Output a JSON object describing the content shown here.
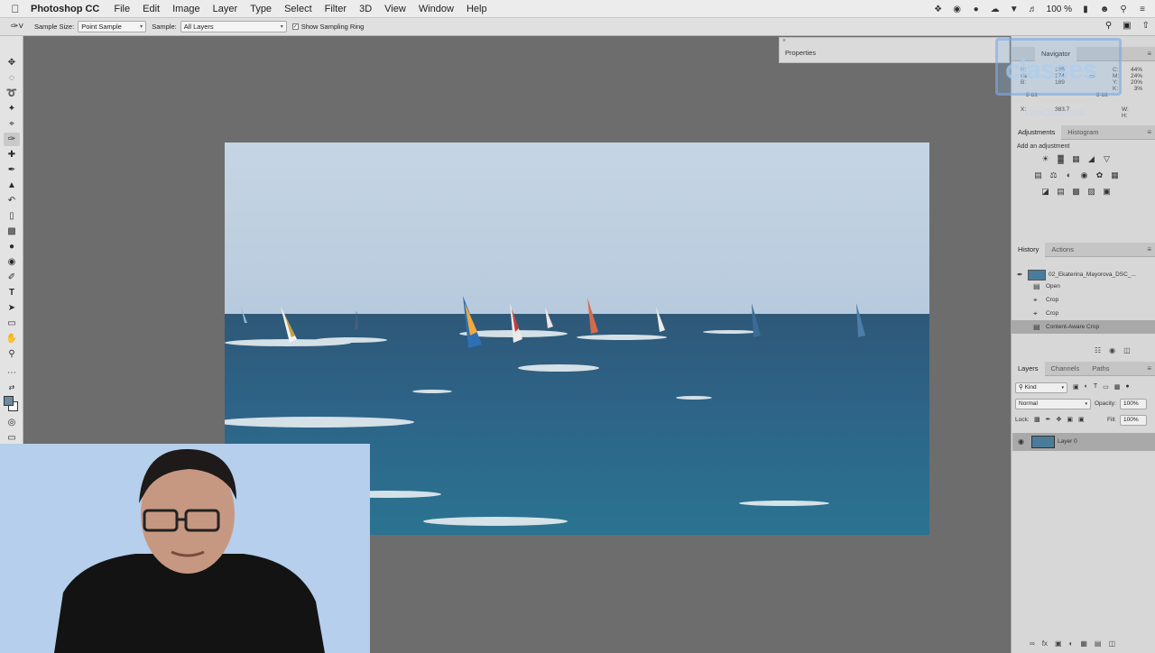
{
  "menubar": {
    "app_name": "Photoshop CC",
    "items": [
      "File",
      "Edit",
      "Image",
      "Layer",
      "Type",
      "Select",
      "Filter",
      "3D",
      "View",
      "Window",
      "Help"
    ],
    "battery": "100 %"
  },
  "options_bar": {
    "sample_size_label": "Sample Size:",
    "sample_size_value": "Point Sample",
    "sample_label": "Sample:",
    "sample_value": "All Layers",
    "sampling_ring_label": "Show Sampling Ring",
    "sampling_ring_checked": true
  },
  "properties": {
    "title": "Properties"
  },
  "navigator": {
    "tab": "Navigator",
    "info": {
      "r_label": "R:",
      "r": "165",
      "g_label": "G:",
      "g": "174",
      "b_label": "B:",
      "b": "189",
      "bit1": "8-bit",
      "c_label": "C:",
      "c": "44%",
      "m_label": "M:",
      "m": "24%",
      "y_label": "Y:",
      "y": "20%",
      "k_label": "K:",
      "k": "3%",
      "bit2": "8-bit",
      "x_label": "X:",
      "x": "383.7",
      "w_label": "W:",
      "h_label": "H:"
    }
  },
  "watermark": {
    "logo_text": "classes",
    "url_text": "LiveClasses.ru"
  },
  "adjustments": {
    "tabs": [
      "Adjustments",
      "Histogram"
    ],
    "heading": "Add an adjustment"
  },
  "history": {
    "tabs": [
      "History",
      "Actions"
    ],
    "snapshot": "02_Ekaterina_Mayorova_DSC_...",
    "steps": [
      "Open",
      "Crop",
      "Crop",
      "Content-Aware Crop"
    ],
    "active_step_index": 3
  },
  "layers": {
    "tabs": [
      "Layers",
      "Channels",
      "Paths"
    ],
    "kind": "Kind",
    "blend_mode": "Normal",
    "opacity_label": "Opacity:",
    "opacity": "100%",
    "lock_label": "Lock:",
    "fill_label": "Fill:",
    "fill": "100%",
    "layer_name": "Layer 0"
  },
  "colors": {
    "foreground": "#6d8ba0",
    "background": "#ffffff",
    "workspace": "#6d6d6d",
    "sky": "#c3d3e2",
    "sea": "#2e5f80"
  }
}
